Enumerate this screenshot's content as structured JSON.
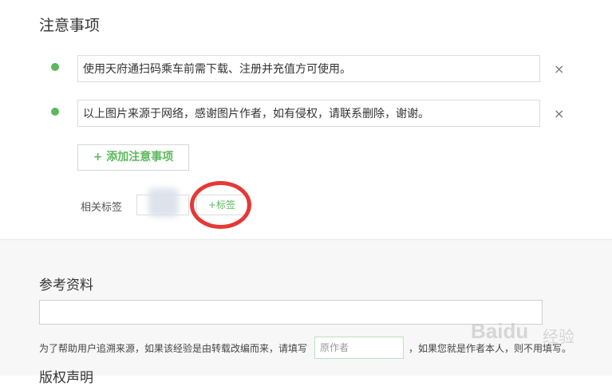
{
  "notes_section": {
    "title": "注意事项",
    "items": [
      {
        "text": "使用天府通扫码乘车前需下载、注册并充值方可使用。"
      },
      {
        "text": "以上图片来源于网络，感谢图片作者，如有侵权，请联系删除，谢谢。"
      }
    ],
    "remove_icon": "×",
    "add_button_label": "+ 添加注意事项"
  },
  "tags": {
    "label": "相关标签",
    "add_tag_label": "+标签"
  },
  "reference": {
    "title": "参考资料",
    "help_prefix": "为了帮助用户追溯来源，如果该经验是由转载改编而来，请填写",
    "author_placeholder": "原作者",
    "help_suffix": "，如果您就是作者本人，则不用填写。"
  },
  "copyright": {
    "title": "版权声明"
  },
  "watermark": {
    "text": "Baidu",
    "sub": "经验"
  },
  "colors": {
    "accent_green": "#5cb85c",
    "annotation_red": "#e53935"
  }
}
